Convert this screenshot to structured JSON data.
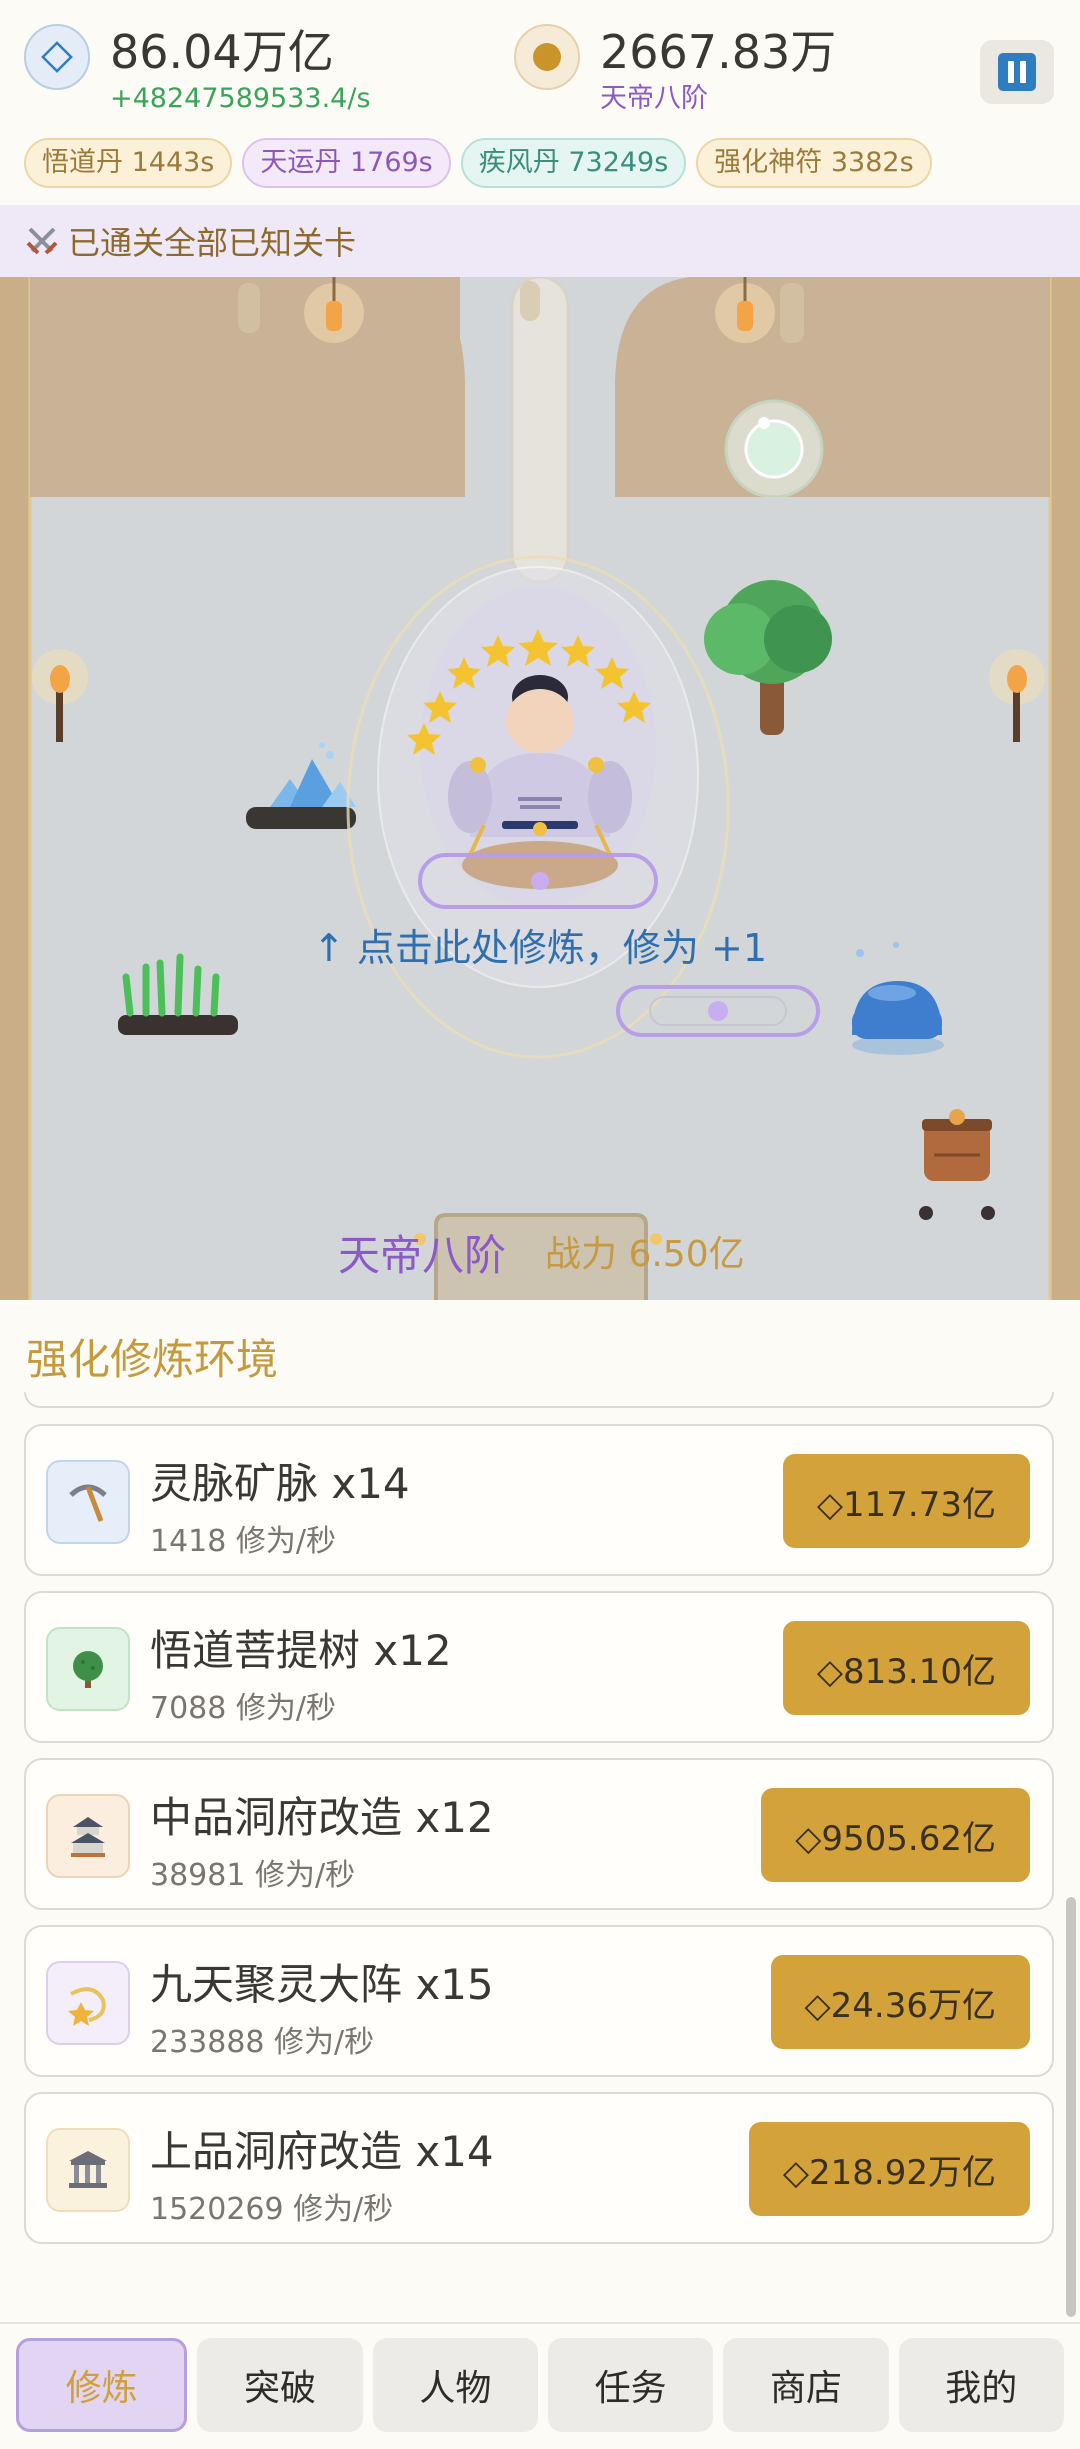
{
  "header": {
    "cultivation": {
      "icon": "diamond-icon",
      "value": "86.04万亿",
      "rate": "+48247589533.4/s"
    },
    "spirit_stones": {
      "icon": "coin-icon",
      "value": "2667.83万",
      "realm": "天帝八阶"
    },
    "pause_icon": "pause-icon"
  },
  "buffs": [
    {
      "label": "悟道丹 1443s",
      "color": "#c9a056"
    },
    {
      "label": "天运丹 1769s",
      "color": "#a068c8"
    },
    {
      "label": "疾风丹 73249s",
      "color": "#3a9c8c"
    },
    {
      "label": "强化神符 3382s",
      "color": "#b98a3c"
    }
  ],
  "banner": {
    "icon": "crossed-swords-icon",
    "text": "已通关全部已知关卡"
  },
  "scene": {
    "hint": "↑ 点击此处修炼，修为 +1",
    "rank": "天帝八阶",
    "power": "战力 6.50亿"
  },
  "panel": {
    "title": "强化修炼环境",
    "items": [
      {
        "name": "灵脉矿脉  x14",
        "rate": "1418 修为/秒",
        "cost": "◇117.73亿",
        "icon": "pickaxe-icon"
      },
      {
        "name": "悟道菩提树  x12",
        "rate": "7088 修为/秒",
        "cost": "◇813.10亿",
        "icon": "tree-icon"
      },
      {
        "name": "中品洞府改造  x12",
        "rate": "38981 修为/秒",
        "cost": "◇9505.62亿",
        "icon": "castle-icon"
      },
      {
        "name": "九天聚灵大阵  x15",
        "rate": "233888 修为/秒",
        "cost": "◇24.36万亿",
        "icon": "star-swirl-icon"
      },
      {
        "name": "上品洞府改造  x14",
        "rate": "1520269 修为/秒",
        "cost": "◇218.92万亿",
        "icon": "temple-icon"
      }
    ]
  },
  "nav": {
    "tabs": [
      {
        "label": "修炼",
        "active": true
      },
      {
        "label": "突破"
      },
      {
        "label": "人物"
      },
      {
        "label": "任务"
      },
      {
        "label": "商店"
      },
      {
        "label": "我的"
      }
    ]
  }
}
